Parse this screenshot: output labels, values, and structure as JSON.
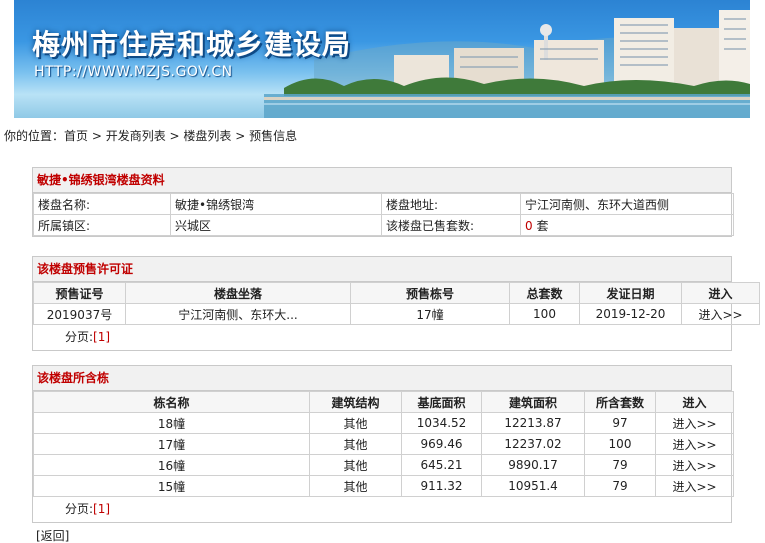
{
  "banner": {
    "title": "梅州市住房和城乡建设局",
    "url": "HTTP://WWW.MZJS.GOV.CN"
  },
  "breadcrumb": {
    "prefix": "你的位置：",
    "items": [
      "首页",
      "开发商列表",
      "楼盘列表",
      "预售信息"
    ],
    "sep": " > "
  },
  "project": {
    "heading": "敏捷•锦绣银湾楼盘资料",
    "name_label": "楼盘名称:",
    "name_value": "敏捷•锦绣银湾",
    "address_label": "楼盘地址:",
    "address_value": "宁江河南侧、东环大道西侧",
    "district_label": "所属镇区:",
    "district_value": "兴城区",
    "sold_label": "该楼盘已售套数:",
    "sold_value": "0",
    "sold_unit": " 套"
  },
  "permits": {
    "heading": "该楼盘预售许可证",
    "columns": [
      "预售证号",
      "楼盘坐落",
      "预售栋号",
      "总套数",
      "发证日期",
      "进入"
    ],
    "rows": [
      [
        "2019037号",
        "宁江河南侧、东环大...",
        "17幢",
        "100",
        "2019-12-20",
        "进入>>"
      ]
    ],
    "pager_label": "分页:",
    "pager_value": "[1]"
  },
  "buildings": {
    "heading": "该楼盘所含栋",
    "columns": [
      "栋名称",
      "建筑结构",
      "基底面积",
      "建筑面积",
      "所含套数",
      "进入"
    ],
    "rows": [
      [
        "18幢",
        "其他",
        "1034.52",
        "12213.87",
        "97",
        "进入>>"
      ],
      [
        "17幢",
        "其他",
        "969.46",
        "12237.02",
        "100",
        "进入>>"
      ],
      [
        "16幢",
        "其他",
        "645.21",
        "9890.17",
        "79",
        "进入>>"
      ],
      [
        "15幢",
        "其他",
        "911.32",
        "10951.4",
        "79",
        "进入>>"
      ]
    ],
    "pager_label": "分页:",
    "pager_value": "[1]"
  },
  "back_label": "[返回]"
}
